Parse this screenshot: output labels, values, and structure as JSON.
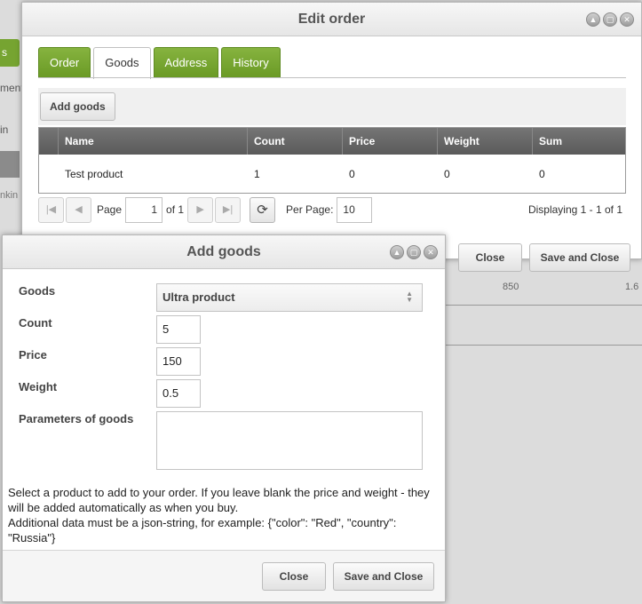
{
  "background": {
    "tab_fragment": "s",
    "text_fragments": [
      "ment",
      "in",
      "nkin"
    ],
    "numbers": [
      "850",
      "1.6"
    ]
  },
  "edit_order": {
    "title": "Edit order",
    "tabs": [
      {
        "label": "Order",
        "active": false
      },
      {
        "label": "Goods",
        "active": true
      },
      {
        "label": "Address",
        "active": false
      },
      {
        "label": "History",
        "active": false
      }
    ],
    "add_goods_label": "Add goods",
    "grid": {
      "columns": [
        "Name",
        "Count",
        "Price",
        "Weight",
        "Sum"
      ],
      "rows": [
        [
          "Test product",
          "1",
          "0",
          "0",
          "0"
        ]
      ]
    },
    "pager": {
      "page_label": "Page",
      "page_value": "1",
      "of_label": "of 1",
      "per_page_label": "Per Page:",
      "per_page_value": "10",
      "displaying": "Displaying 1 - 1 of 1"
    },
    "close_label": "Close",
    "save_close_label": "Save and Close"
  },
  "add_goods": {
    "title": "Add goods",
    "fields": {
      "goods_label": "Goods",
      "goods_value": "Ultra product",
      "count_label": "Count",
      "count_value": "5",
      "price_label": "Price",
      "price_value": "150",
      "weight_label": "Weight",
      "weight_value": "0.5",
      "params_label": "Parameters of goods",
      "params_value": ""
    },
    "help_line1": "Select a product to add to your order. If you leave blank the price and weight - they will be added automatically as when you buy.",
    "help_line2": "Additional data must be a json-string, for example: {\"color\": \"Red\", \"country\": \"Russia\"}",
    "close_label": "Close",
    "save_close_label": "Save and Close"
  },
  "colors": {
    "tab_green": "#76a431",
    "grid_header": "#666666"
  }
}
